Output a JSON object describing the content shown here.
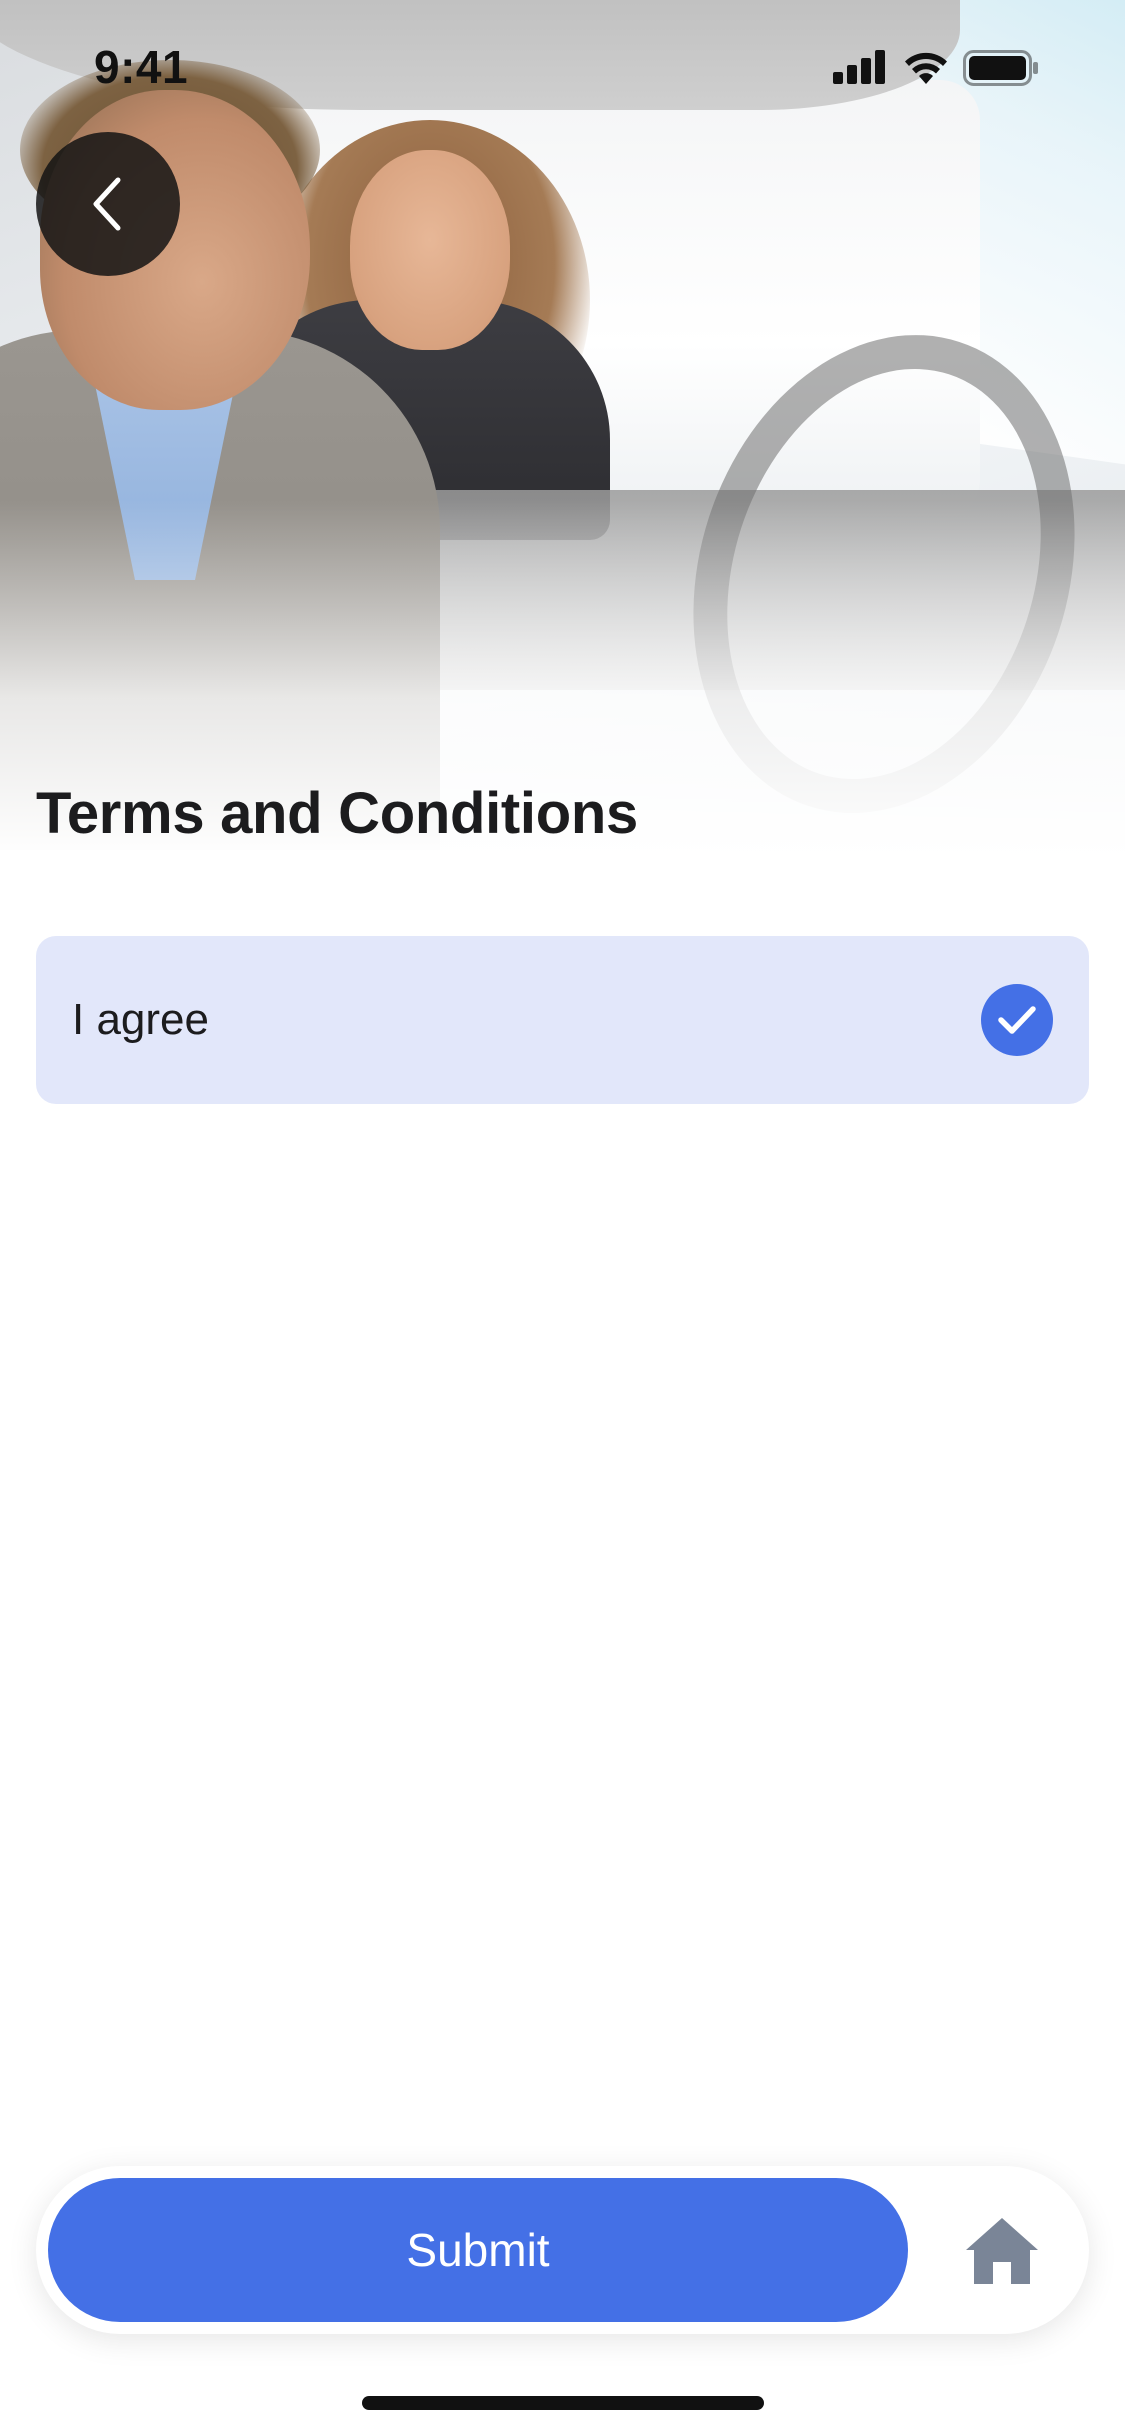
{
  "status_bar": {
    "time": "9:41",
    "icons": [
      "signal-icon",
      "wifi-icon",
      "battery-icon"
    ]
  },
  "hero": {
    "image": "hero-photo-car-dealership",
    "back_icon": "chevron-left-icon"
  },
  "page": {
    "title": "Terms and Conditions"
  },
  "agreement": {
    "label": "I agree",
    "checked": true,
    "check_icon": "checkmark-icon"
  },
  "bottom_bar": {
    "submit_label": "Submit",
    "home_icon": "home-icon"
  },
  "colors": {
    "accent": "#4470e6",
    "option_background": "#e2e7fa",
    "title_text": "#1c1c1e",
    "home_icon": "#7a8597"
  }
}
